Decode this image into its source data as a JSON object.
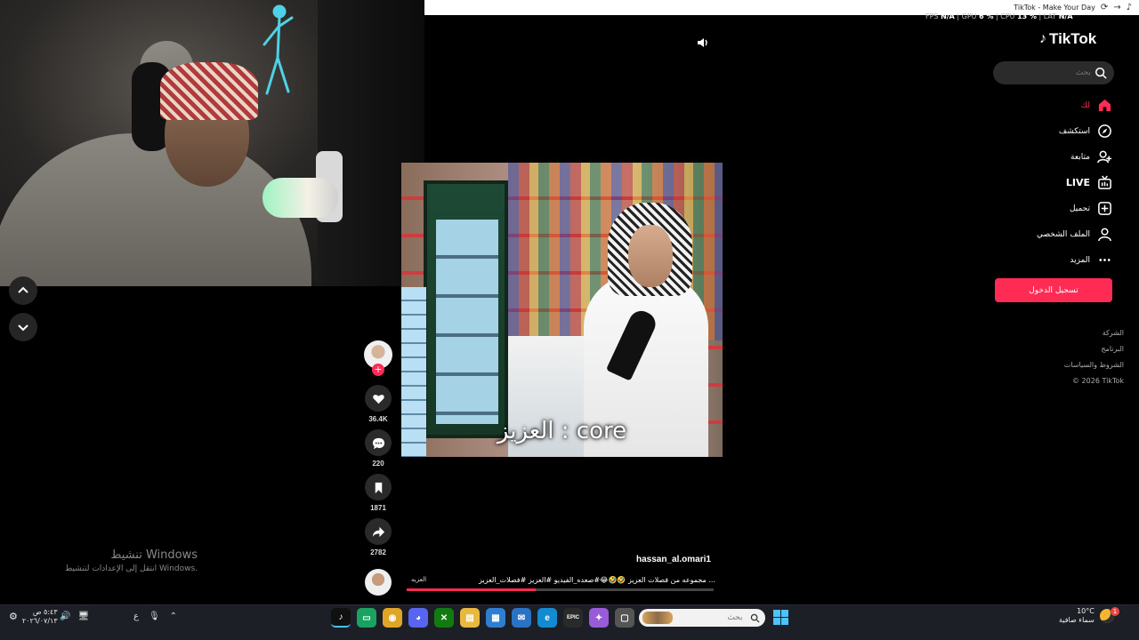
{
  "browser": {
    "tab_title": "TikTok - Make Your Day"
  },
  "perf_overlay": {
    "fps_label": "FPS",
    "fps": "N/A",
    "gpu_label": "GPU",
    "gpu": "6 %",
    "cpu_label": "CPU",
    "cpu": "13 %",
    "lat_label": "LAT",
    "lat": "N/A"
  },
  "tiktok": {
    "logo": "TikTok",
    "search_placeholder": "بحث",
    "nav": [
      {
        "label": "لك",
        "icon": "home-icon",
        "active": true
      },
      {
        "label": "استكشف",
        "icon": "compass-icon"
      },
      {
        "label": "متابعة",
        "icon": "user-plus-icon"
      },
      {
        "label": "LIVE",
        "icon": "live-icon"
      },
      {
        "label": "تحميل",
        "icon": "upload-icon"
      },
      {
        "label": "الملف الشخصي",
        "icon": "profile-icon"
      },
      {
        "label": "المزيد",
        "icon": "more-icon"
      }
    ],
    "login_label": "تسجيل الدخول",
    "footer": [
      "الشركة",
      "البرنامج",
      "الشروط والسياسات",
      "© 2026 TikTok"
    ],
    "accent": "#fe2c55"
  },
  "video": {
    "caption": "العزيز : core",
    "author": "hassan_al.omari1",
    "description": "مجموعه من فصلات العزيز 🤣🤣😂#صعده_الفيديو #العزيز #فصلات_العزيز ...",
    "music": "العزيه",
    "progress": 0.42
  },
  "actions": {
    "likes": "36.4K",
    "comments": "220",
    "saves": "1871",
    "shares": "2782"
  },
  "windows_activation": {
    "title": "تنشيط Windows",
    "subtitle": "انتقل إلى الإعدادات لتنشيط Windows."
  },
  "taskbar": {
    "weather_temp": "10°C",
    "weather_desc": "سماء صافية",
    "notification_count": "1",
    "search_placeholder": "بحث",
    "time": "٥:٤٣ ص",
    "date": "٢٠٢٦/٠٧/١٣",
    "lang": "ع",
    "apps": [
      {
        "name": "tiktok",
        "glyph": "♪",
        "color": "#111111",
        "active": true
      },
      {
        "name": "terminal",
        "glyph": "▭",
        "color": "#1aa260"
      },
      {
        "name": "chrome",
        "glyph": "◉",
        "color": "#e0a526"
      },
      {
        "name": "discord",
        "glyph": "◕",
        "color": "#5865f2"
      },
      {
        "name": "xbox",
        "glyph": "✕",
        "color": "#107c10"
      },
      {
        "name": "files",
        "glyph": "▤",
        "color": "#e8b93c"
      },
      {
        "name": "store",
        "glyph": "▦",
        "color": "#2d7fd1"
      },
      {
        "name": "mail",
        "glyph": "✉",
        "color": "#2a72c4"
      },
      {
        "name": "edge",
        "glyph": "e",
        "color": "#138bd1"
      },
      {
        "name": "epic",
        "glyph": "EPIC",
        "color": "#2a2a2a"
      },
      {
        "name": "copilot",
        "glyph": "✦",
        "color": "#9a5bd8"
      },
      {
        "name": "app-window",
        "glyph": "▢",
        "color": "#555555"
      }
    ]
  }
}
